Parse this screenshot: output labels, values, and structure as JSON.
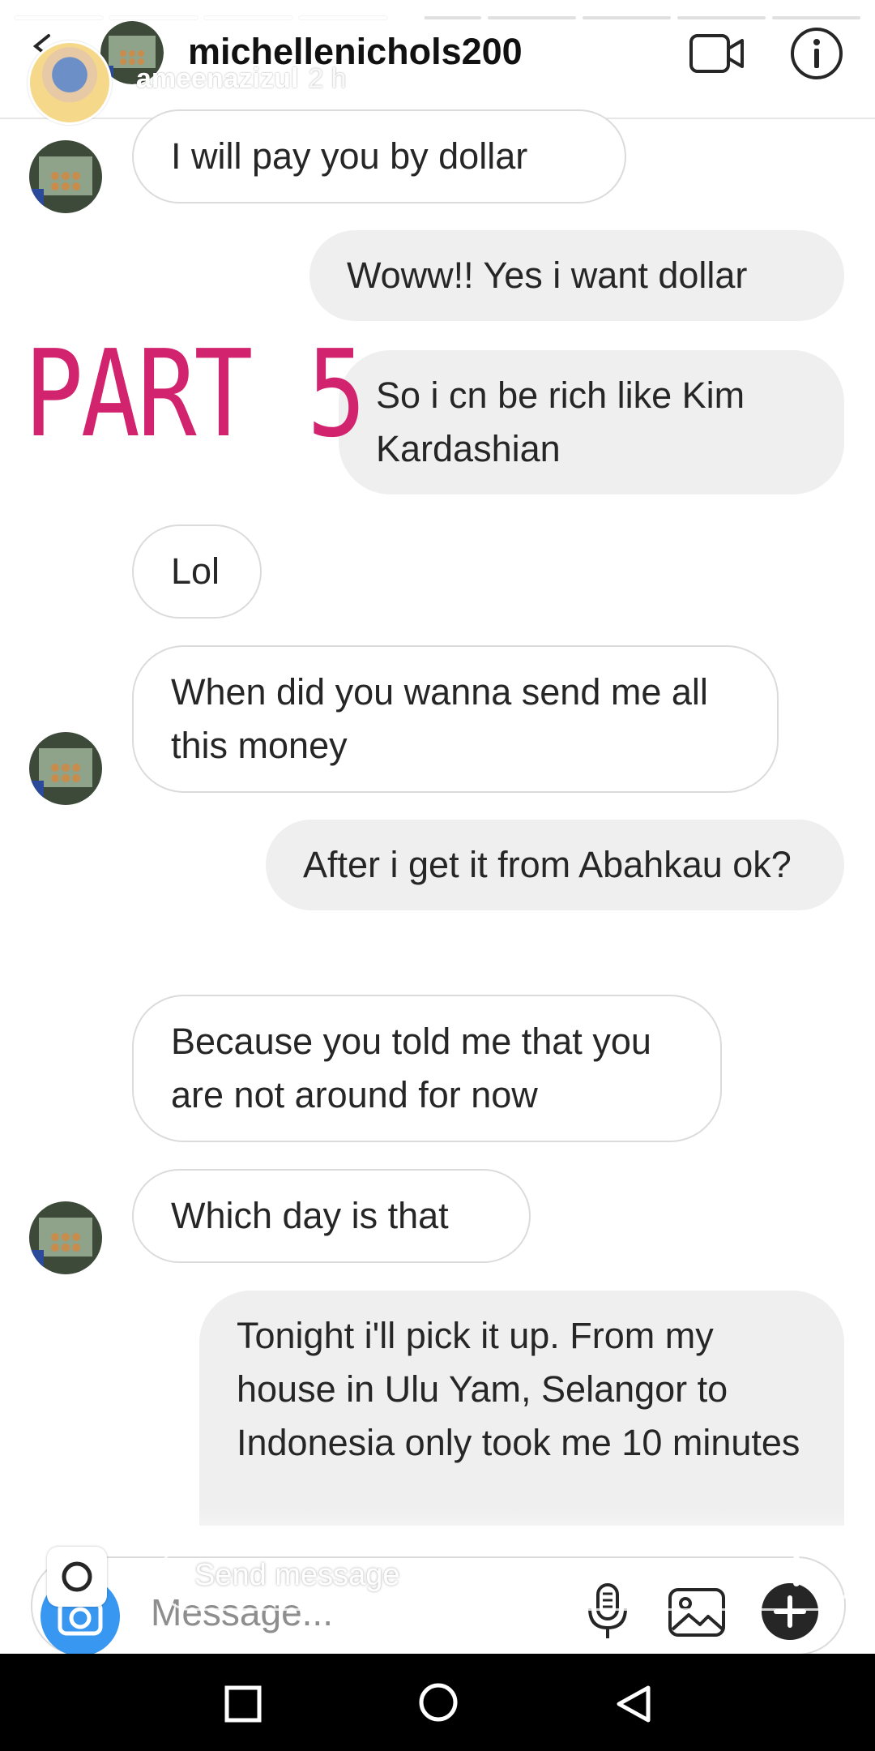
{
  "header": {
    "title": "michellenichols200",
    "story_user": "ameenazizul",
    "story_time": "2 h"
  },
  "overlay": {
    "sticker_text": "PART 5"
  },
  "messages": [
    {
      "dir": "in",
      "text": "I will pay  you by dollar"
    },
    {
      "dir": "out",
      "text": "Woww!! Yes i want dollar"
    },
    {
      "dir": "out",
      "text": "So i cn be rich like Kim Kardashian"
    },
    {
      "dir": "in",
      "text": "Lol"
    },
    {
      "dir": "in",
      "text": "When did you wanna send me all this  money"
    },
    {
      "dir": "out",
      "text": "After i get it from Abahkau ok?"
    },
    {
      "dir": "in",
      "text": "Because  you told me that you are not around  for now"
    },
    {
      "dir": "in",
      "text": "Which day is that"
    },
    {
      "dir": "out",
      "text": "Tonight i'll pick it up. From my house in Ulu Yam, Selangor to Indonesia only took me 10 minutes"
    }
  ],
  "composer": {
    "placeholder": "Message...",
    "story_reply_placeholder": "Send message"
  },
  "icons": {
    "back": "chevron-left-icon",
    "video": "video-call-icon",
    "info": "info-icon",
    "camera": "camera-icon",
    "mic": "microphone-icon",
    "gallery": "gallery-icon",
    "plus": "plus-icon",
    "nav_recent": "square-icon",
    "nav_home": "circle-icon",
    "nav_back": "triangle-back-icon"
  },
  "colors": {
    "accent_blue": "#3897f0",
    "sticker_pink": "#d2246e",
    "outgoing_bubble": "#efefef"
  }
}
